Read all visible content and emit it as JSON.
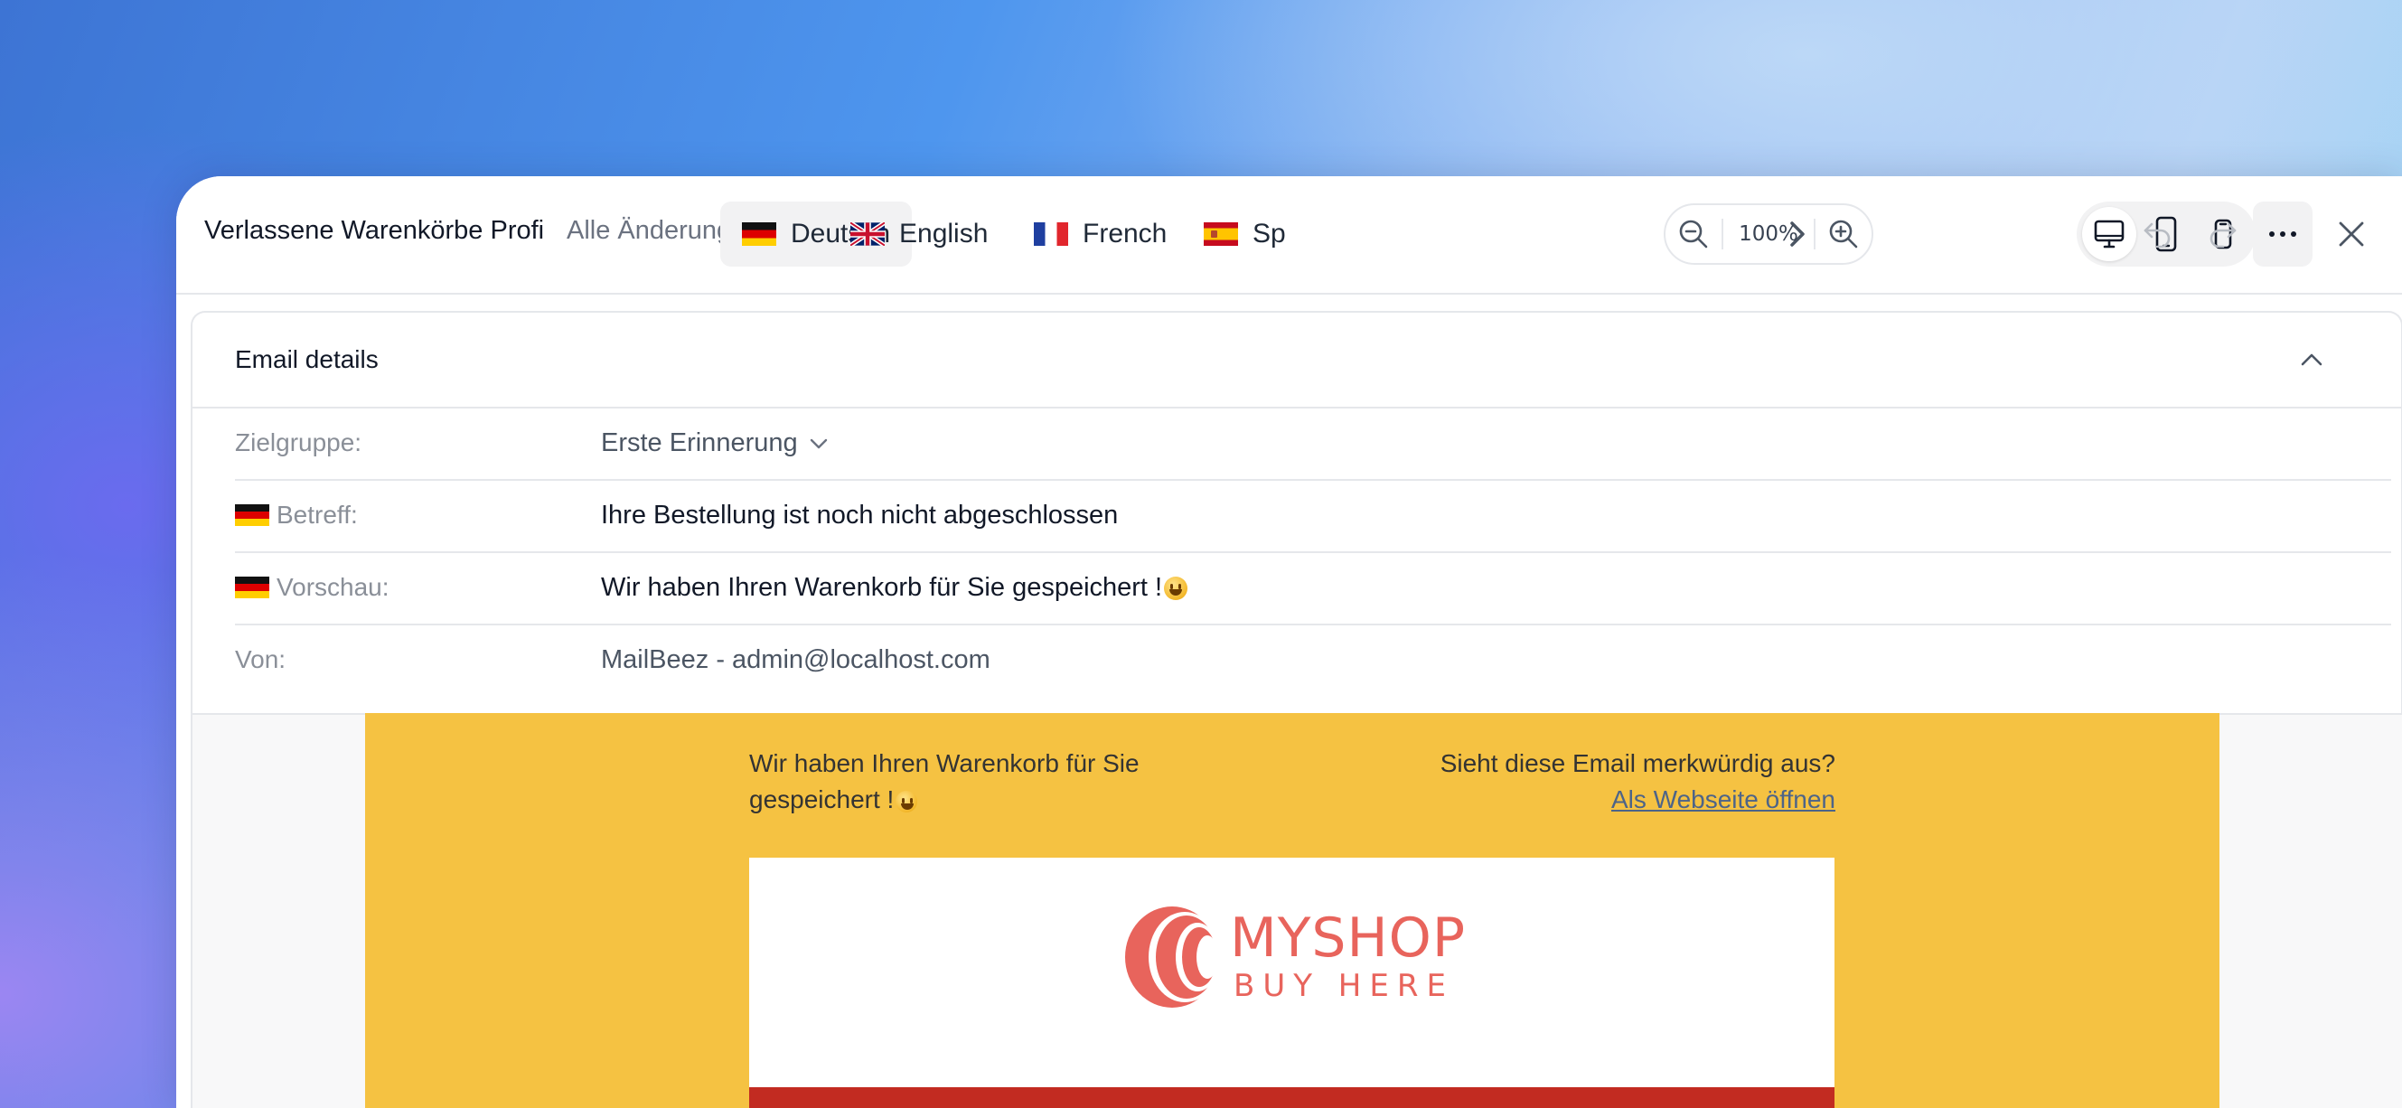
{
  "toolbar": {
    "campaign_title": "Verlassene Warenkörbe Profi",
    "save_status": "Alle Änderungen gespeichert",
    "languages": [
      {
        "label": "Deutsch",
        "flag": "de",
        "active": true
      },
      {
        "label": "English",
        "flag": "gb",
        "active": false
      },
      {
        "label": "French",
        "flag": "fr",
        "active": false
      },
      {
        "label": "Sp",
        "flag": "es",
        "active": false
      }
    ],
    "zoom_level": "100%",
    "device_modes": [
      "desktop",
      "tablet",
      "mobile"
    ],
    "active_device": "desktop"
  },
  "details": {
    "title": "Email details",
    "fields": {
      "audience": {
        "label": "Zielgruppe:",
        "value": "Erste Erinnerung"
      },
      "subject": {
        "label": "Betreff:",
        "value": "Ihre Bestellung ist noch nicht abgeschlossen"
      },
      "preview": {
        "label": "Vorschau:",
        "value": "Wir haben Ihren Warenkorb für Sie gespeichert !"
      },
      "from": {
        "label": "Von:",
        "value": "MailBeez - admin@localhost.com"
      }
    }
  },
  "email": {
    "preheader": "Wir haben Ihren Warenkorb für Sie gespeichert !",
    "view_question": "Sieht diese Email merkwürdig aus?",
    "view_link": "Als Webseite öffnen",
    "logo_line1": "MYSHOP",
    "logo_line2": "BUY HERE"
  },
  "colors": {
    "email_background": "#f5c242",
    "brand_logo": "#e8645c",
    "band_red": "#c22b21",
    "active_tab_bg": "#f2f2f3"
  }
}
